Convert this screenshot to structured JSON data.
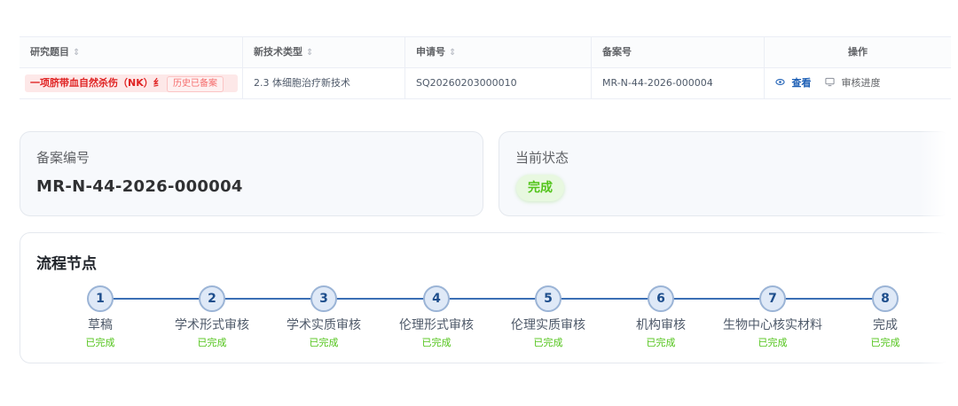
{
  "table": {
    "headers": [
      "研究题目",
      "新技术类型",
      "申请号",
      "备案号",
      "操作"
    ],
    "sort_icon": "⇕",
    "row": {
      "title": "一项脐带血自然杀伤（NK）纟",
      "history_tag": "历史已备案",
      "tech_type": "2.3 体细胞治疗新技术",
      "application_no": "SQ20260203000010",
      "record_no": "MR-N-44-2026-000004"
    },
    "actions": {
      "view_label": "查看",
      "view_icon": "eye-icon",
      "progress_label": "审核进度",
      "progress_icon": "monitor-icon"
    }
  },
  "record_card": {
    "label": "备案编号",
    "value": "MR-N-44-2026-000004"
  },
  "status_card": {
    "label": "当前状态",
    "status": "完成"
  },
  "flow": {
    "title": "流程节点",
    "steps": [
      {
        "num": "1",
        "name": "草稿",
        "status": "已完成"
      },
      {
        "num": "2",
        "name": "学术形式审核",
        "status": "已完成"
      },
      {
        "num": "3",
        "name": "学术实质审核",
        "status": "已完成"
      },
      {
        "num": "4",
        "name": "伦理形式审核",
        "status": "已完成"
      },
      {
        "num": "5",
        "name": "伦理实质审核",
        "status": "已完成"
      },
      {
        "num": "6",
        "name": "机构审核",
        "status": "已完成"
      },
      {
        "num": "7",
        "name": "生物中心核实材料",
        "status": "已完成"
      },
      {
        "num": "8",
        "name": "完成",
        "status": "已完成"
      }
    ]
  },
  "colors": {
    "danger": "#e02424",
    "link": "#1d5fb5",
    "success": "#52c41a",
    "step_line": "#3b6fb5"
  }
}
